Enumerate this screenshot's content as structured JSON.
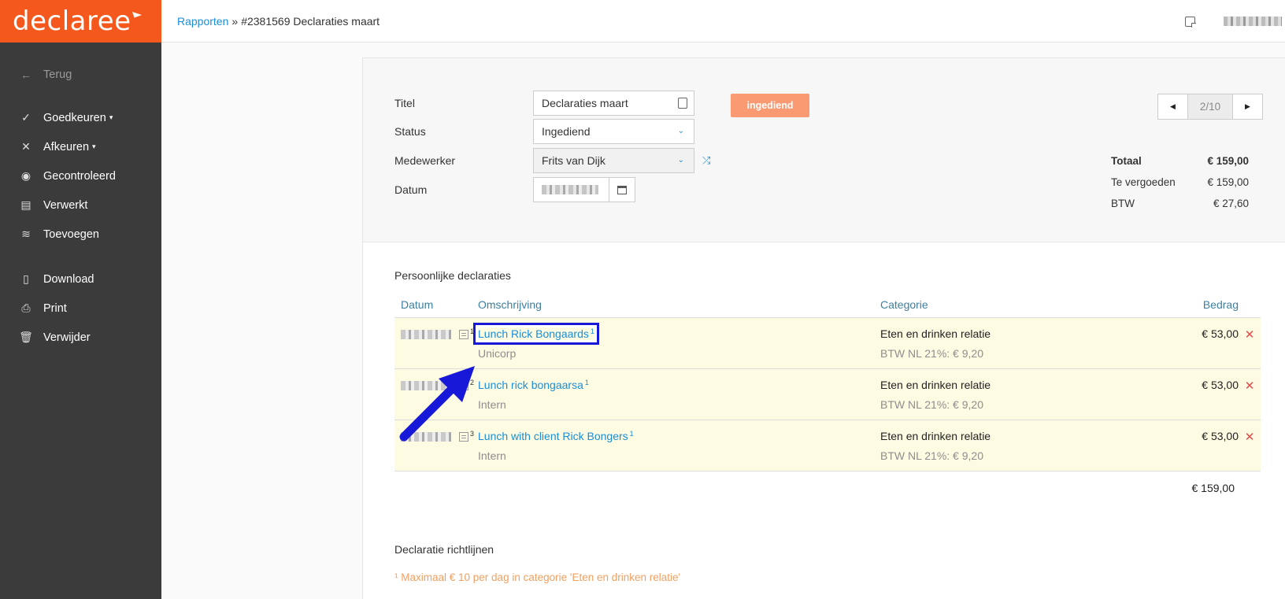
{
  "brand": {
    "logo": "declaree"
  },
  "sidebar": {
    "back": "Terug",
    "items": [
      {
        "label": "Goedkeuren",
        "icon": "check-icon",
        "dropdown": true
      },
      {
        "label": "Afkeuren",
        "icon": "x-icon",
        "dropdown": true
      },
      {
        "label": "Gecontroleerd",
        "icon": "eye-icon"
      },
      {
        "label": "Verwerkt",
        "icon": "archive-icon"
      },
      {
        "label": "Toevoegen",
        "icon": "coins-icon"
      }
    ],
    "items2": [
      {
        "label": "Download",
        "icon": "pdf-icon"
      },
      {
        "label": "Print",
        "icon": "printer-icon"
      },
      {
        "label": "Verwijder",
        "icon": "trash-icon"
      }
    ]
  },
  "header": {
    "breadcrumb_link": "Rapporten",
    "breadcrumb_sep": "»",
    "breadcrumb_current": "#2381569 Declaraties maart"
  },
  "form": {
    "title_label": "Titel",
    "title_value": "Declaraties maart",
    "status_label": "Status",
    "status_value": "Ingediend",
    "employee_label": "Medewerker",
    "employee_value": "Frits van Dijk",
    "date_label": "Datum"
  },
  "status_badge": "ingediend",
  "pager": {
    "position": "2/10"
  },
  "totals": {
    "total_label": "Totaal",
    "total_value": "€ 159,00",
    "refund_label": "Te vergoeden",
    "refund_value": "€ 159,00",
    "vat_label": "BTW",
    "vat_value": "€ 27,60"
  },
  "table": {
    "section_title": "Persoonlijke declaraties",
    "headers": {
      "date": "Datum",
      "description": "Omschrijving",
      "category": "Categorie",
      "amount": "Bedrag"
    },
    "rows": [
      {
        "doc": "1",
        "title": "Lunch Rick Bongaards",
        "note": "1",
        "sub": "Unicorp",
        "category": "Eten en drinken relatie",
        "vat": "BTW NL 21%: € 9,20",
        "amount": "€ 53,00"
      },
      {
        "doc": "2",
        "title": "Lunch rick bongaarsa",
        "note": "1",
        "sub": "Intern",
        "category": "Eten en drinken relatie",
        "vat": "BTW NL 21%: € 9,20",
        "amount": "€ 53,00"
      },
      {
        "doc": "3",
        "title": "Lunch with client Rick Bongers",
        "note": "1",
        "sub": "Intern",
        "category": "Eten en drinken relatie",
        "vat": "BTW NL 21%: € 9,20",
        "amount": "€ 53,00"
      }
    ],
    "total": "€ 159,00"
  },
  "rules": {
    "title": "Declaratie richtlijnen",
    "note": "¹ Maximaal € 10 per dag in categorie 'Eten en drinken relatie'"
  },
  "colors": {
    "brand": "#f4581c",
    "sidebar": "#3b3b3b",
    "link": "#1a8ed8",
    "badge": "#f99a72",
    "row_highlight": "#fdfbe2",
    "annotation": "#1818d8"
  }
}
